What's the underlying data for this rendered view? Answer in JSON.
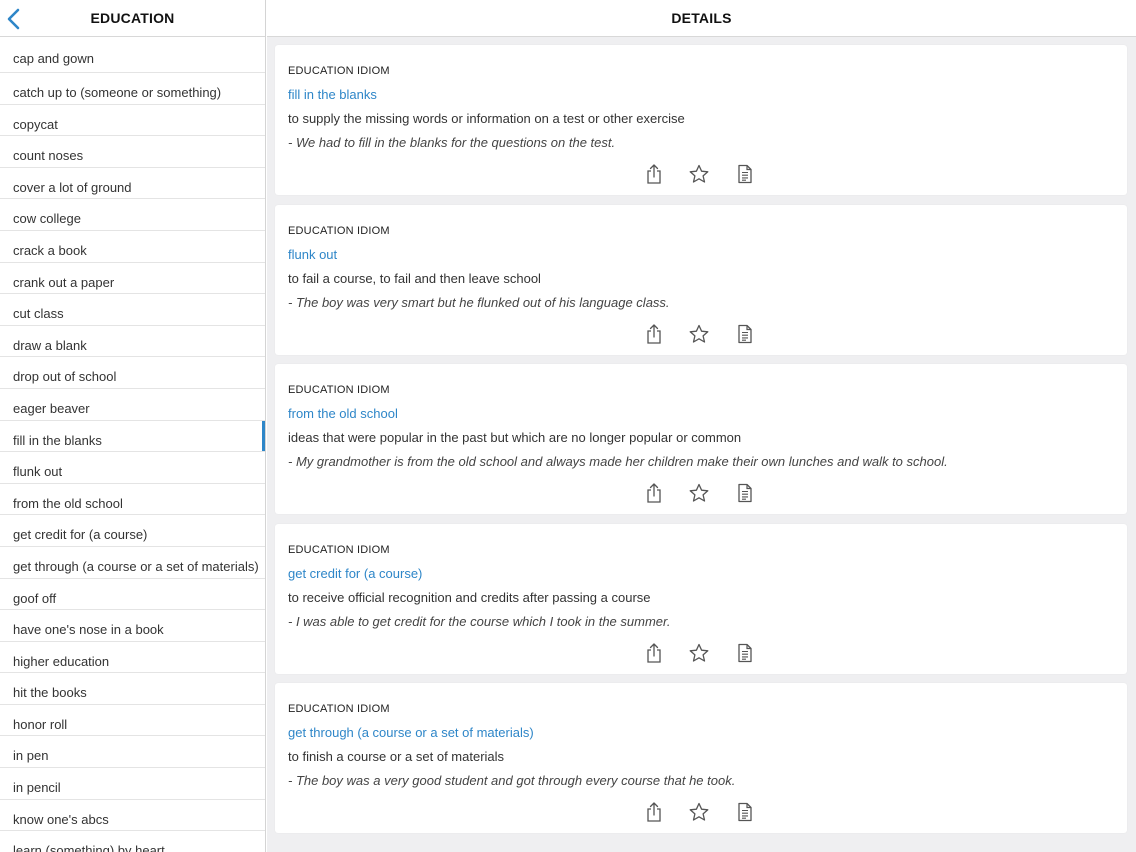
{
  "sidebar": {
    "title": "EDUCATION",
    "back_icon": "chevron-left-icon",
    "items": [
      {
        "label": "cap and gown"
      },
      {
        "label": "catch up to (someone or something)"
      },
      {
        "label": "copycat"
      },
      {
        "label": "count noses"
      },
      {
        "label": "cover a lot of ground"
      },
      {
        "label": "cow college"
      },
      {
        "label": "crack a book"
      },
      {
        "label": "crank out a paper"
      },
      {
        "label": "cut class"
      },
      {
        "label": "draw a blank"
      },
      {
        "label": "drop out of school"
      },
      {
        "label": "eager beaver"
      },
      {
        "label": "fill in the blanks",
        "selected": true
      },
      {
        "label": "flunk out"
      },
      {
        "label": "from the old school"
      },
      {
        "label": "get credit for (a course)"
      },
      {
        "label": "get through (a course or a set of materials)"
      },
      {
        "label": "goof off"
      },
      {
        "label": "have one's nose in a book"
      },
      {
        "label": "higher education"
      },
      {
        "label": "hit the books"
      },
      {
        "label": "honor roll"
      },
      {
        "label": "in pen"
      },
      {
        "label": "in pencil"
      },
      {
        "label": "know one's abcs"
      },
      {
        "label": "learn (something) by heart"
      }
    ]
  },
  "main": {
    "title": "DETAILS",
    "cards": [
      {
        "category": "EDUCATION IDIOM",
        "term": "fill in the blanks",
        "definition": "to supply the missing words or information on a test or other exercise",
        "example": "- We had to fill in the blanks for the questions on the test."
      },
      {
        "category": "EDUCATION IDIOM",
        "term": "flunk out",
        "definition": "to fail a course, to fail and then leave school",
        "example": "- The boy was very smart but he flunked out of his language class."
      },
      {
        "category": "EDUCATION IDIOM",
        "term": "from the old school",
        "definition": "ideas that were popular in the past but which are no longer popular or common",
        "example": "- My grandmother is from the old school and always made her children make their own lunches and walk to school."
      },
      {
        "category": "EDUCATION IDIOM",
        "term": "get credit for (a course)",
        "definition": "to receive official recognition and credits after passing a course",
        "example": "- I was able to get credit for the course which I took in the summer."
      },
      {
        "category": "EDUCATION IDIOM",
        "term": "get through (a course or a set of materials)",
        "definition": "to finish a course or a set of materials",
        "example": "- The boy was a very good student and got through every course that he took."
      }
    ],
    "card_actions": [
      "share-icon",
      "star-icon",
      "document-icon"
    ]
  },
  "colors": {
    "accent": "#2e86c8",
    "background": "#efeff1",
    "card": "#ffffff"
  }
}
